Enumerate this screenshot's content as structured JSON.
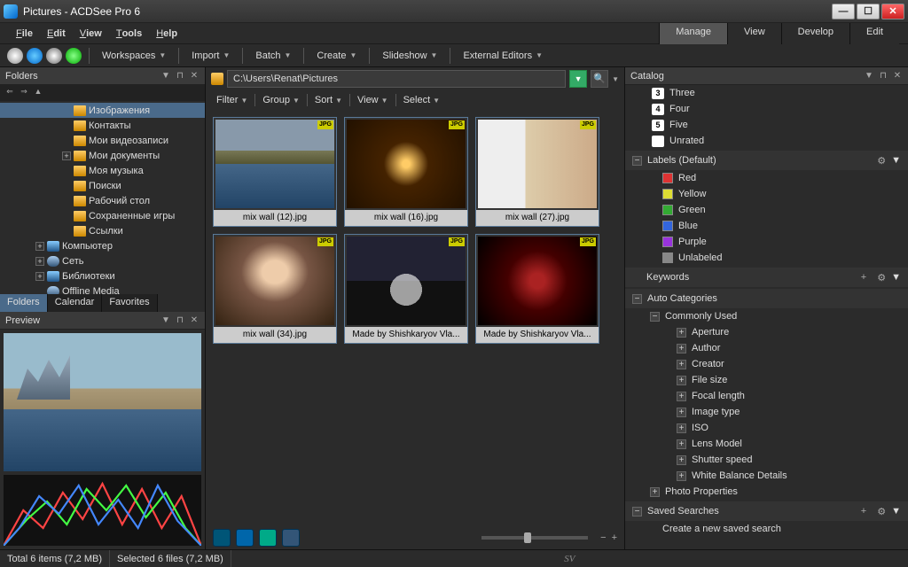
{
  "window": {
    "title": "Pictures - ACDSee Pro 6"
  },
  "menu": {
    "file": "File",
    "edit": "Edit",
    "view": "View",
    "tools": "Tools",
    "help": "Help"
  },
  "modes": {
    "manage": "Manage",
    "view": "View",
    "develop": "Develop",
    "edit": "Edit"
  },
  "toolbar": {
    "workspaces": "Workspaces",
    "import": "Import",
    "batch": "Batch",
    "create": "Create",
    "slideshow": "Slideshow",
    "external": "External Editors"
  },
  "folders": {
    "title": "Folders",
    "items": [
      {
        "label": "Изображения",
        "indent": 70,
        "sel": true,
        "toggle": ""
      },
      {
        "label": "Контакты",
        "indent": 70,
        "toggle": ""
      },
      {
        "label": "Мои видеозаписи",
        "indent": 70,
        "toggle": ""
      },
      {
        "label": "Мои документы",
        "indent": 70,
        "toggle": "+"
      },
      {
        "label": "Моя музыка",
        "indent": 70,
        "toggle": ""
      },
      {
        "label": "Поиски",
        "indent": 70,
        "toggle": ""
      },
      {
        "label": "Рабочий стол",
        "indent": 70,
        "toggle": ""
      },
      {
        "label": "Сохраненные игры",
        "indent": 70,
        "toggle": ""
      },
      {
        "label": "Ссылки",
        "indent": 70,
        "toggle": ""
      },
      {
        "label": "Компьютер",
        "indent": 40,
        "toggle": "+",
        "ico": "drive"
      },
      {
        "label": "Сеть",
        "indent": 40,
        "toggle": "+",
        "ico": "net"
      },
      {
        "label": "Библиотеки",
        "indent": 40,
        "toggle": "+",
        "ico": "drive"
      },
      {
        "label": "Offline Media",
        "indent": 40,
        "toggle": "",
        "ico": "net"
      }
    ]
  },
  "left_tabs": {
    "folders": "Folders",
    "calendar": "Calendar",
    "favorites": "Favorites"
  },
  "preview": {
    "title": "Preview"
  },
  "address": {
    "path": "C:\\Users\\Renat\\Pictures"
  },
  "filters": {
    "filter": "Filter",
    "group": "Group",
    "sort": "Sort",
    "view": "View",
    "select": "Select"
  },
  "thumbs": [
    {
      "label": "mix wall (12).jpg",
      "cls": "t0"
    },
    {
      "label": "mix wall (16).jpg",
      "cls": "t1"
    },
    {
      "label": "mix wall (27).jpg",
      "cls": "t2"
    },
    {
      "label": "mix wall (34).jpg",
      "cls": "t3"
    },
    {
      "label": "Made by Shishkaryov Vla...",
      "cls": "t4"
    },
    {
      "label": "Made by Shishkaryov Vla...",
      "cls": "t5"
    }
  ],
  "catalog": {
    "title": "Catalog",
    "ratings": [
      {
        "n": "3",
        "t": "Three"
      },
      {
        "n": "4",
        "t": "Four"
      },
      {
        "n": "5",
        "t": "Five"
      },
      {
        "n": "",
        "t": "Unrated"
      }
    ],
    "labels_title": "Labels (Default)",
    "labels": [
      {
        "c": "#d33",
        "t": "Red"
      },
      {
        "c": "#dd3",
        "t": "Yellow"
      },
      {
        "c": "#3a3",
        "t": "Green"
      },
      {
        "c": "#36d",
        "t": "Blue"
      },
      {
        "c": "#93d",
        "t": "Purple"
      },
      {
        "c": "#888",
        "t": "Unlabeled"
      }
    ],
    "keywords": "Keywords",
    "autocat": "Auto Categories",
    "common": "Commonly Used",
    "props": [
      "Aperture",
      "Author",
      "Creator",
      "File size",
      "Focal length",
      "Image type",
      "ISO",
      "Lens Model",
      "Shutter speed",
      "White Balance Details"
    ],
    "photo_props": "Photo Properties",
    "saved": "Saved Searches",
    "new_search": "Create a new saved search"
  },
  "status": {
    "total": "Total 6 items (7,2 MB)",
    "selected": "Selected 6 files (7,2 MB)",
    "sv": "SV"
  }
}
